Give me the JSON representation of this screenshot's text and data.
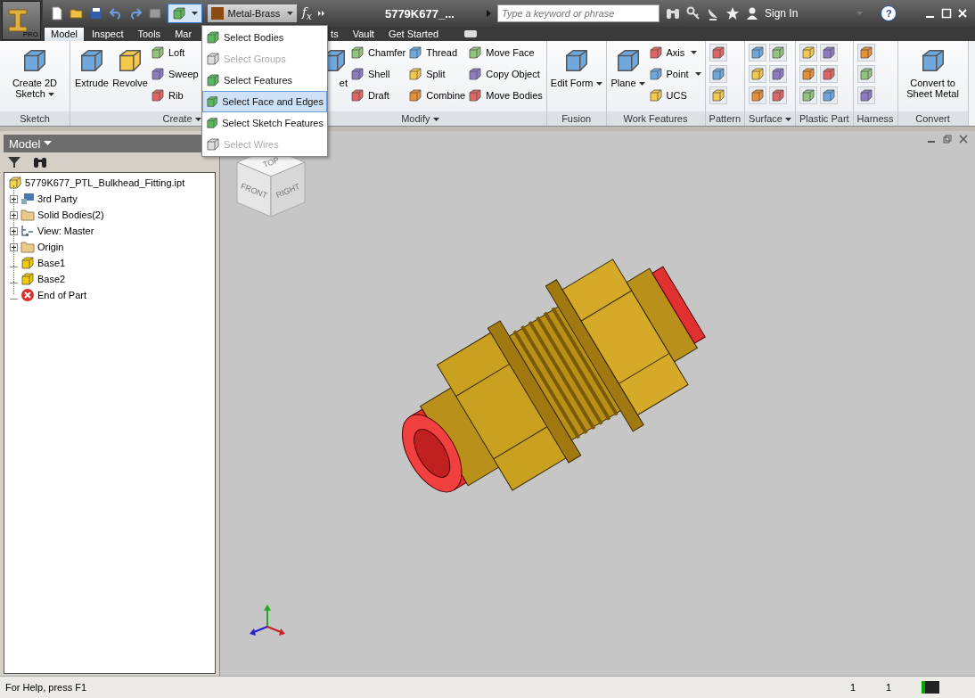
{
  "title_bar": {
    "app_badge": "PRO",
    "material": "Metal-Brass",
    "formula_button": "f$_{x}$",
    "document_title": "5779K677_...",
    "search": {
      "placeholder": "Type a keyword or phrase"
    },
    "sign_in": "Sign In",
    "help_button": "?"
  },
  "selection_menu": {
    "open": true,
    "items": [
      {
        "label": "Select Bodies",
        "disabled": false,
        "selected": false
      },
      {
        "label": "Select Groups",
        "disabled": true,
        "selected": false
      },
      {
        "label": "Select Features",
        "disabled": false,
        "selected": false
      },
      {
        "label": "Select Face and Edges",
        "disabled": false,
        "selected": true
      },
      {
        "label": "Select Sketch Features",
        "disabled": false,
        "selected": false
      },
      {
        "label": "Select Wires",
        "disabled": true,
        "selected": false
      }
    ]
  },
  "tabs": [
    {
      "label": "Model",
      "selected": true
    },
    {
      "label": "Inspect",
      "selected": false
    },
    {
      "label": "Tools",
      "selected": false
    },
    {
      "label": "Mar",
      "selected": false
    },
    {
      "label": "ts",
      "selected": false
    },
    {
      "label": "Vault",
      "selected": false
    },
    {
      "label": "Get Started",
      "selected": false
    }
  ],
  "ribbon": {
    "panels": [
      {
        "title": "Sketch",
        "title_menu": false,
        "items": [
          {
            "kind": "large",
            "label": "Create 2D Sketch",
            "has_menu": true
          }
        ]
      },
      {
        "title": "Create",
        "title_menu": true,
        "items": [
          {
            "kind": "large",
            "label": "Extrude",
            "has_menu": false
          },
          {
            "kind": "large",
            "label": "Revolve",
            "has_menu": false
          },
          {
            "kind": "small",
            "label": "Loft",
            "has_menu": false
          },
          {
            "kind": "small",
            "label": "Sweep",
            "has_menu": false
          },
          {
            "kind": "small",
            "label": "Rib",
            "has_menu": false
          }
        ]
      },
      {
        "title": "Modify",
        "title_menu": true,
        "items": [
          {
            "kind": "large",
            "label": "et",
            "has_menu": false
          },
          {
            "kind": "small",
            "label": "Chamfer",
            "has_menu": false
          },
          {
            "kind": "small",
            "label": "Shell",
            "has_menu": false
          },
          {
            "kind": "small",
            "label": "Draft",
            "has_menu": false
          },
          {
            "kind": "small",
            "label": "Thread",
            "has_menu": false
          },
          {
            "kind": "small",
            "label": "Split",
            "has_menu": false
          },
          {
            "kind": "small",
            "label": "Combine",
            "has_menu": false
          },
          {
            "kind": "small",
            "label": "Move Face",
            "has_menu": false
          },
          {
            "kind": "small",
            "label": "Copy Object",
            "has_menu": false
          },
          {
            "kind": "small",
            "label": "Move Bodies",
            "has_menu": false
          }
        ]
      },
      {
        "title": "Fusion",
        "title_menu": false,
        "items": [
          {
            "kind": "large",
            "label": "Edit Form",
            "has_menu": true
          }
        ]
      },
      {
        "title": "Work Features",
        "title_menu": false,
        "items": [
          {
            "kind": "large",
            "label": "Plane",
            "has_menu": true
          },
          {
            "kind": "small",
            "label": "Axis",
            "has_menu": true
          },
          {
            "kind": "small",
            "label": "Point",
            "has_menu": true
          },
          {
            "kind": "small",
            "label": "UCS",
            "has_menu": false
          }
        ]
      },
      {
        "title": "Pattern",
        "title_menu": false,
        "items": [
          {
            "kind": "icon"
          },
          {
            "kind": "icon"
          },
          {
            "kind": "icon"
          }
        ]
      },
      {
        "title": "Surface",
        "title_menu": true,
        "items": [
          {
            "kind": "icon"
          },
          {
            "kind": "icon"
          },
          {
            "kind": "icon"
          },
          {
            "kind": "icon"
          },
          {
            "kind": "icon"
          },
          {
            "kind": "icon"
          }
        ]
      },
      {
        "title": "Plastic Part",
        "title_menu": false,
        "items": [
          {
            "kind": "icon"
          },
          {
            "kind": "icon"
          },
          {
            "kind": "icon"
          },
          {
            "kind": "icon"
          },
          {
            "kind": "icon"
          },
          {
            "kind": "icon"
          }
        ]
      },
      {
        "title": "Harness",
        "title_menu": false,
        "items": [
          {
            "kind": "icon"
          },
          {
            "kind": "icon"
          },
          {
            "kind": "icon"
          }
        ]
      },
      {
        "title": "Convert",
        "title_menu": false,
        "items": [
          {
            "kind": "large",
            "label": "Convert to Sheet Metal",
            "has_menu": false
          }
        ]
      }
    ]
  },
  "browser": {
    "title": "Model",
    "tree": {
      "label": "5779K677_PTL_Bulkhead_Fitting.ipt",
      "kind": "part",
      "children": [
        {
          "label": "3rd Party",
          "kind": "third-party",
          "expandable": true
        },
        {
          "label": "Solid Bodies(2)",
          "kind": "bodies-folder",
          "expandable": true
        },
        {
          "label": "View: Master",
          "kind": "view",
          "expandable": true
        },
        {
          "label": "Origin",
          "kind": "folder",
          "expandable": true
        },
        {
          "label": "Base1",
          "kind": "body",
          "expandable": false
        },
        {
          "label": "Base2",
          "kind": "body",
          "expandable": false
        },
        {
          "label": "End of Part",
          "kind": "end",
          "expandable": false
        }
      ]
    }
  },
  "viewport": {
    "view_cube": {
      "top": "TOP",
      "front": "FRONT",
      "right": "RIGHT"
    }
  },
  "status_bar": {
    "message": "For Help, press F1",
    "field_1": "1",
    "field_2": "1"
  }
}
